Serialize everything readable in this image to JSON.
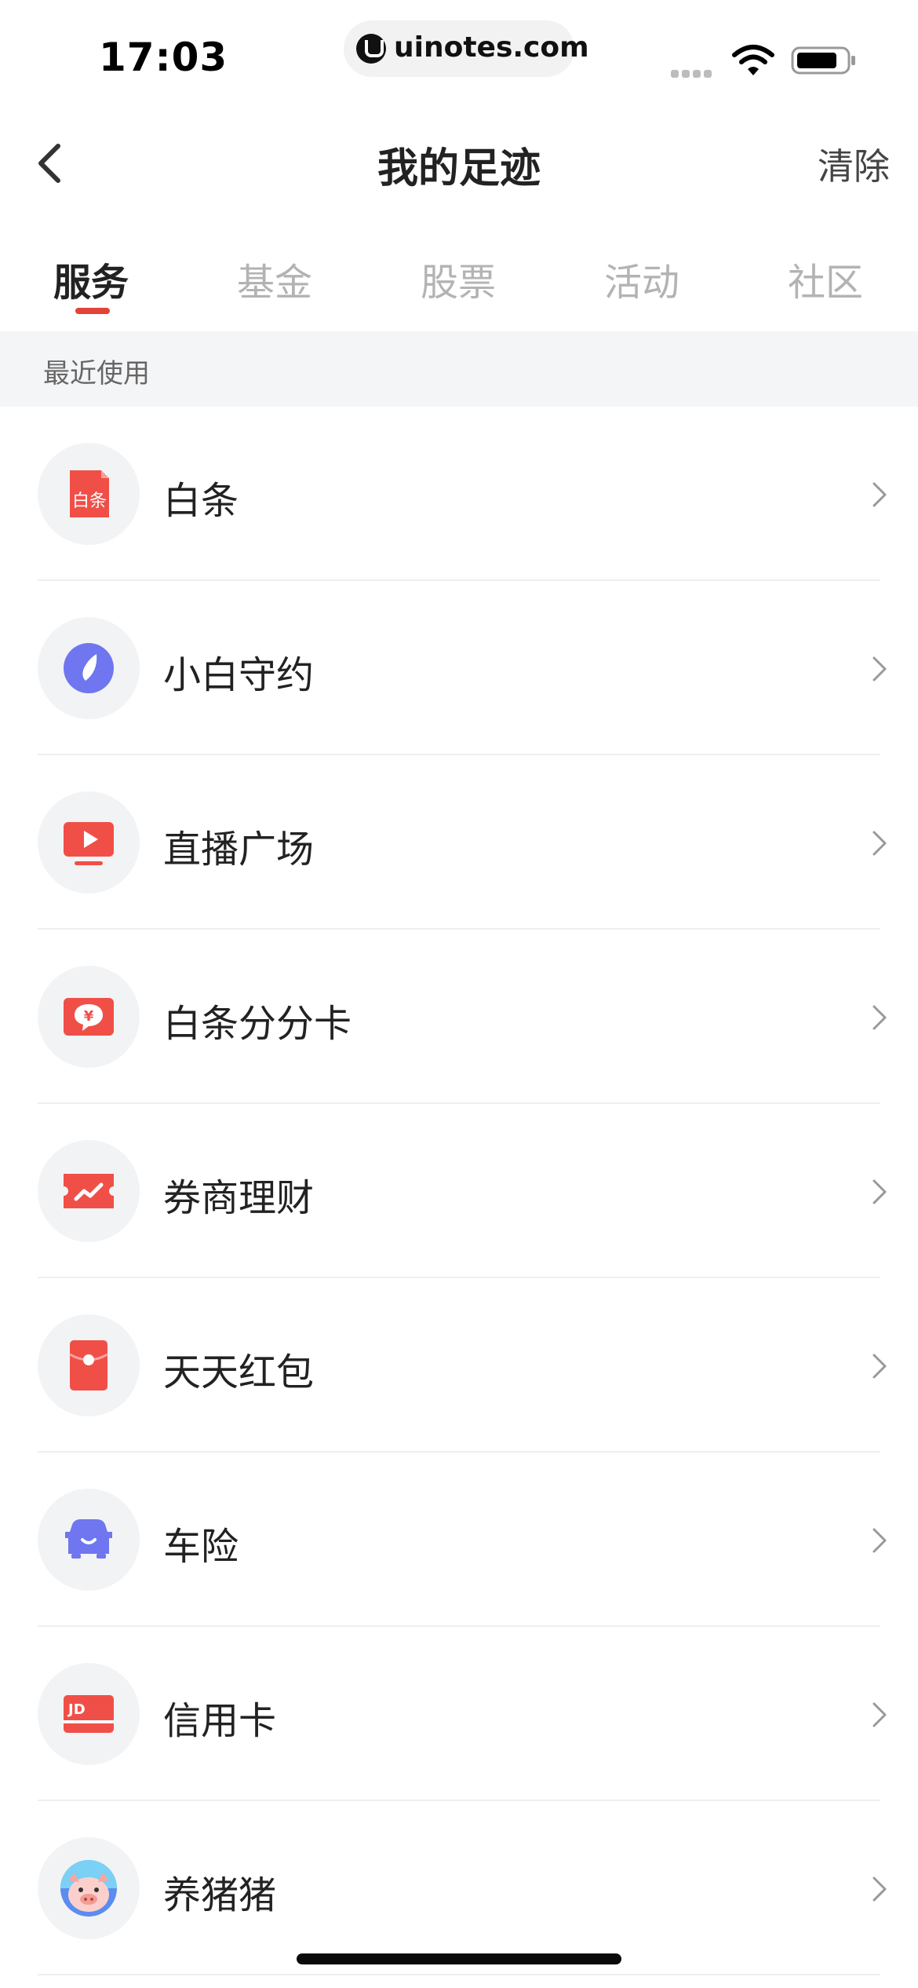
{
  "status_bar": {
    "time": "17:03",
    "url": "uinotes.com"
  },
  "nav": {
    "title": "我的足迹",
    "clear_label": "清除"
  },
  "tabs": [
    {
      "label": "服务",
      "active": true
    },
    {
      "label": "基金",
      "active": false
    },
    {
      "label": "股票",
      "active": false
    },
    {
      "label": "活动",
      "active": false
    },
    {
      "label": "社区",
      "active": false
    }
  ],
  "section": {
    "title": "最近使用"
  },
  "items": [
    {
      "label": "白条",
      "icon": "baitiao-icon",
      "icon_text": "白条"
    },
    {
      "label": "小白守约",
      "icon": "compass-icon"
    },
    {
      "label": "直播广场",
      "icon": "live-tv-icon"
    },
    {
      "label": "白条分分卡",
      "icon": "yen-chat-icon",
      "icon_text": "¥"
    },
    {
      "label": "券商理财",
      "icon": "ticket-trend-icon"
    },
    {
      "label": "天天红包",
      "icon": "red-envelope-icon"
    },
    {
      "label": "车险",
      "icon": "car-icon"
    },
    {
      "label": "信用卡",
      "icon": "jd-card-icon",
      "icon_text": "JD"
    },
    {
      "label": "养猪猪",
      "icon": "pig-icon"
    }
  ],
  "colors": {
    "accent": "#e2443a",
    "purple": "#6f76f0",
    "section_bg": "#f4f5f7"
  }
}
